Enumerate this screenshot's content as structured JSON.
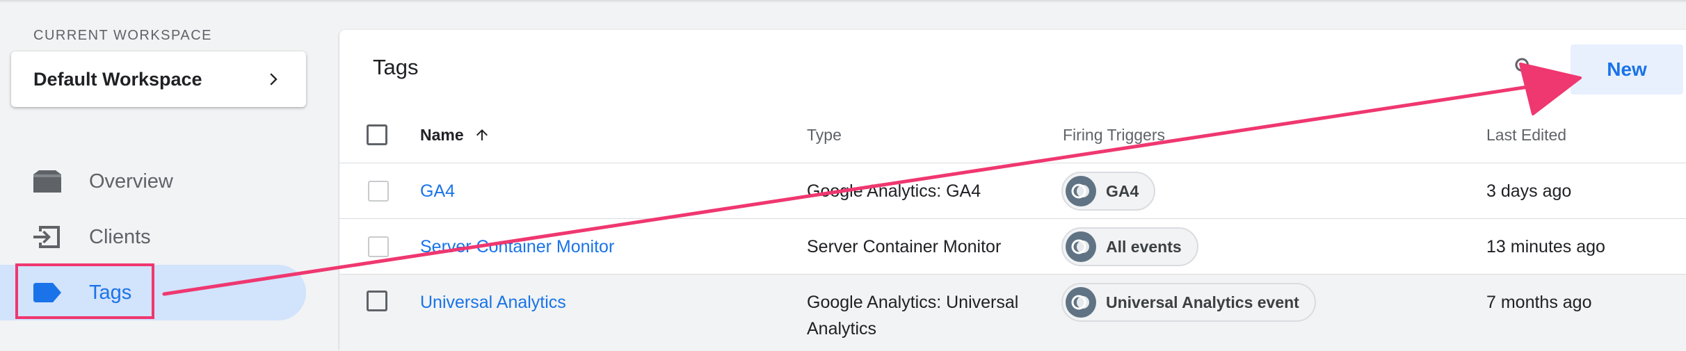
{
  "sidebar": {
    "workspace_label": "CURRENT WORKSPACE",
    "workspace_name": "Default Workspace",
    "items": [
      {
        "label": "Overview",
        "icon": "folder-icon"
      },
      {
        "label": "Clients",
        "icon": "login-icon"
      },
      {
        "label": "Tags",
        "icon": "tag-icon"
      }
    ]
  },
  "main": {
    "title": "Tags",
    "new_label": "New",
    "columns": {
      "name": "Name",
      "type": "Type",
      "triggers": "Firing Triggers",
      "edited": "Last Edited"
    },
    "rows": [
      {
        "name": "GA4",
        "type": "Google Analytics: GA4",
        "trigger": "GA4",
        "edited": "3 days ago"
      },
      {
        "name": "Server Container Monitor",
        "type": "Server Container Monitor",
        "trigger": "All events",
        "edited": "13 minutes ago"
      },
      {
        "name": "Universal Analytics",
        "type_line1": "Google Analytics: Universal",
        "type_line2": "Analytics",
        "trigger": "Universal Analytics event",
        "edited": "7 months ago"
      }
    ]
  },
  "annotation": {
    "color": "#ef3770"
  },
  "colors": {
    "accent": "#1a73e8",
    "active_bg": "#d2e3fc",
    "new_bg": "#e8f0fe"
  }
}
